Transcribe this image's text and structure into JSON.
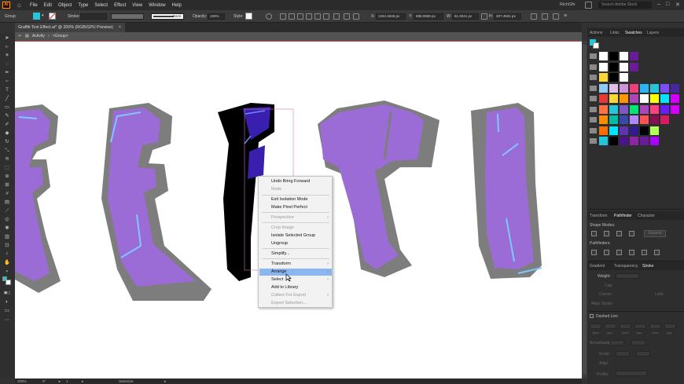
{
  "app": {
    "logo": "Ai",
    "menus": [
      "File",
      "Edit",
      "Object",
      "Type",
      "Select",
      "Effect",
      "View",
      "Window",
      "Help"
    ],
    "user": "RichGfx",
    "search_placeholder": "Search Adobe Stock"
  },
  "control_bar": {
    "selection_label": "Group",
    "stroke_label": "Stroke:",
    "brush_label": "Basic",
    "opacity_label": "Opacity:",
    "opacity_value": "100%",
    "style_label": "Style:",
    "x_label": "X:",
    "x_value": "1264.4946 px",
    "y_label": "Y:",
    "y_value": "686.0869 px",
    "w_label": "W:",
    "w_value": "61.0041 px",
    "h_label": "H:",
    "h_value": "207.4551 px"
  },
  "document": {
    "tab_title": "Graffiti Text Effect.ai* @ 200% (RGB/GPU Preview)",
    "breadcrumb": [
      "Activity",
      "<Group>"
    ]
  },
  "context_menu": {
    "items": [
      {
        "label": "Undo Bring Forward",
        "disabled": false,
        "submenu": false
      },
      {
        "label": "Redo",
        "disabled": true,
        "submenu": false
      },
      {
        "label": "Exit Isolation Mode",
        "disabled": false,
        "submenu": false
      },
      {
        "label": "Make Pixel Perfect",
        "disabled": false,
        "submenu": false
      },
      {
        "label": "Perspective",
        "disabled": true,
        "submenu": true
      },
      {
        "label": "Crop Image",
        "disabled": true,
        "submenu": false
      },
      {
        "label": "Isolate Selected Group",
        "disabled": false,
        "submenu": false
      },
      {
        "label": "Ungroup",
        "disabled": false,
        "submenu": false
      },
      {
        "label": "Simplify...",
        "disabled": false,
        "submenu": false
      },
      {
        "label": "Transform",
        "disabled": false,
        "submenu": true
      },
      {
        "label": "Arrange",
        "disabled": false,
        "submenu": true,
        "highlighted": true
      },
      {
        "label": "Select",
        "disabled": false,
        "submenu": true
      },
      {
        "label": "Add to Library",
        "disabled": false,
        "submenu": false
      },
      {
        "label": "Collect For Export",
        "disabled": true,
        "submenu": true
      },
      {
        "label": "Export Selection...",
        "disabled": true,
        "submenu": false
      }
    ]
  },
  "panels": {
    "top_tabs": [
      "Actions",
      "Links",
      "Swatches",
      "Layers"
    ],
    "middle_tabs": [
      "Transform",
      "Pathfinder",
      "Character"
    ],
    "shape_modes_label": "Shape Modes:",
    "expand_label": "Expand",
    "pathfinders_label": "Pathfinders:",
    "bottom_tabs": [
      "Gradient",
      "Transparency",
      "Stroke"
    ],
    "stroke": {
      "weight_label": "Weight:",
      "cap_label": "Cap:",
      "corner_label": "Corner:",
      "limit_label": "Limit:",
      "align_label": "Align Stroke:",
      "dashed_label": "Dashed Line",
      "dash_labels": [
        "dash",
        "gap",
        "dash",
        "gap",
        "dash",
        "gap"
      ],
      "arrowheads_label": "Arrowheads:",
      "scale_label": "Scale:",
      "align_small_label": "Align:",
      "profile_label": "Profile:"
    },
    "swatch_colors": [
      [
        "#ffffff",
        "#000000",
        "#ffffff",
        "#6a1b9a"
      ],
      [
        "#ffffff",
        "#000000",
        "#ffffff",
        "#6a1b9a"
      ],
      [
        "#fdd835",
        "#000000",
        "#ffffff"
      ],
      [
        "#90caf9",
        "#e1bee7",
        "#ce93d8",
        "#ec407a",
        "#29b6f6",
        "#26c6da",
        "#7c4dff",
        "#4527a0"
      ],
      [
        "#e53935",
        "#fdd835",
        "#ff9800",
        "#ab47bc",
        "#ffffff",
        "#ffff00",
        "#00e5ff",
        "#d500f9"
      ],
      [
        "#ff7043",
        "#26c6da",
        "#7e57c2",
        "#00e676",
        "#ab47bc",
        "#ff4081",
        "#651fff",
        "#d500f9"
      ],
      [
        "#fb8c00",
        "#00bfa5",
        "#3949ab",
        "#b388ff",
        "#ff5252",
        "#880e4f",
        "#d81b60"
      ],
      [
        "#ff6d00",
        "#00e5ff",
        "#5e35b1",
        "#311b92",
        "#000000",
        "#b2ff59"
      ],
      [
        "#26c6da",
        "#000000",
        "#4a148c",
        "#8e24aa",
        "#6a1b9a",
        "#aa00ff"
      ]
    ]
  },
  "status": {
    "zoom": "200%",
    "rotation": "0°",
    "artboard": "1",
    "tool": "Selection"
  }
}
